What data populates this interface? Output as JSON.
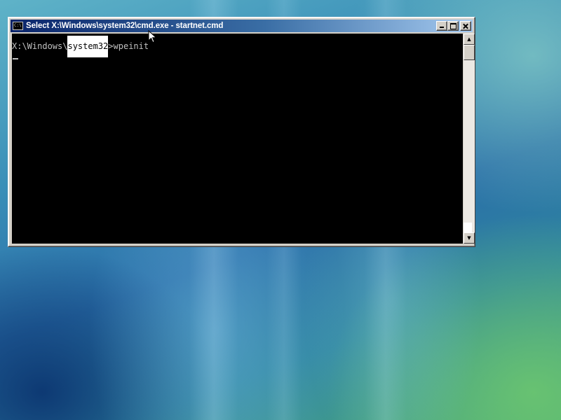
{
  "window": {
    "title": "Select X:\\Windows\\system32\\cmd.exe - startnet.cmd",
    "icon": "cmd-icon",
    "icon_glyph": "C:\\"
  },
  "console": {
    "prompt_prefix": "X:\\Windows\\",
    "prompt_selected": "system32",
    "prompt_suffix": ">",
    "command": "wpeinit"
  },
  "caption_buttons": [
    "minimize",
    "maximize",
    "close"
  ],
  "scrollbar": {
    "up_arrow": "▲",
    "down_arrow": "▼"
  },
  "colors": {
    "console_background": "#000000",
    "console_text": "#c0c0c0",
    "selection_background": "#ffffff",
    "titlebar_start": "#0a246a",
    "titlebar_end": "#a6caf0"
  }
}
